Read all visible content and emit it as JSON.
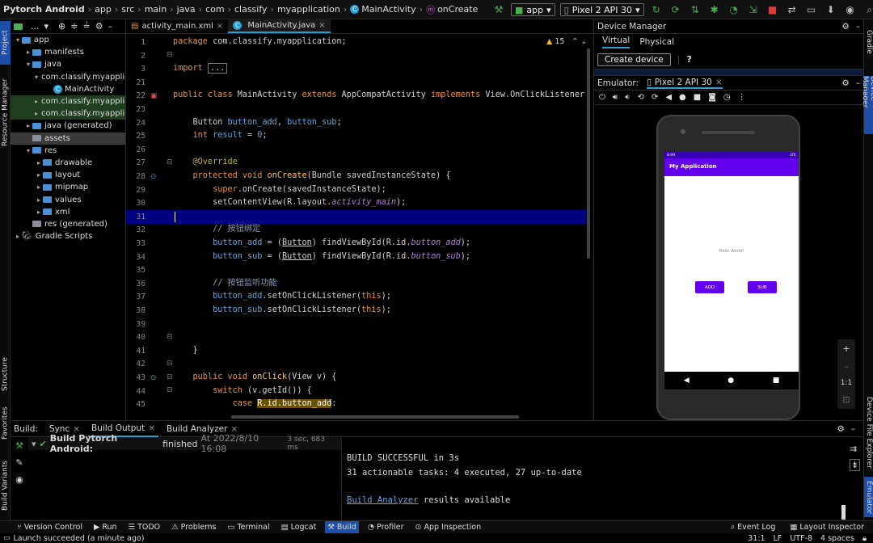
{
  "title_bar": {
    "breadcrumbs": [
      "Pytorch Android",
      "app",
      "src",
      "main",
      "java",
      "com",
      "classify",
      "myapplication",
      "MainActivity",
      "onCreate"
    ],
    "run_config": "app",
    "device": "Pixel 2 API 30"
  },
  "left_strip": {
    "project": "Project",
    "resource_manager": "Resource Manager",
    "structure": "Structure",
    "favorites": "Favorites",
    "build_variants": "Build Variants"
  },
  "right_strip": {
    "gradle": "Gradle",
    "device_manager": "Device Manager",
    "device_file_explorer": "Device File Explorer",
    "emulator": "Emulator"
  },
  "project": {
    "view": "...",
    "tree": [
      {
        "label": "app",
        "depth": 0,
        "icon": "folder",
        "chev": "▾",
        "state": ""
      },
      {
        "label": "manifests",
        "depth": 1,
        "icon": "folder",
        "chev": "▸",
        "state": ""
      },
      {
        "label": "java",
        "depth": 1,
        "icon": "folder",
        "chev": "▾",
        "state": ""
      },
      {
        "label": "com.classify.myapplic",
        "depth": 2,
        "icon": "folder",
        "chev": "▾",
        "state": ""
      },
      {
        "label": "MainActivity",
        "depth": 3,
        "icon": "class",
        "chev": "",
        "state": ""
      },
      {
        "label": "com.classify.myapplica",
        "depth": 2,
        "icon": "folder",
        "chev": "▸",
        "state": "sel"
      },
      {
        "label": "com.classify.myapplica",
        "depth": 2,
        "icon": "folder",
        "chev": "▸",
        "state": "sel"
      },
      {
        "label": "java (generated)",
        "depth": 1,
        "icon": "folder",
        "chev": "▸",
        "state": ""
      },
      {
        "label": "assets",
        "depth": 1,
        "icon": "folder-grey",
        "chev": "",
        "state": "hl"
      },
      {
        "label": "res",
        "depth": 1,
        "icon": "folder",
        "chev": "▾",
        "state": ""
      },
      {
        "label": "drawable",
        "depth": 2,
        "icon": "folder",
        "chev": "▸",
        "state": ""
      },
      {
        "label": "layout",
        "depth": 2,
        "icon": "folder",
        "chev": "▸",
        "state": ""
      },
      {
        "label": "mipmap",
        "depth": 2,
        "icon": "folder",
        "chev": "▸",
        "state": ""
      },
      {
        "label": "values",
        "depth": 2,
        "icon": "folder",
        "chev": "▸",
        "state": ""
      },
      {
        "label": "xml",
        "depth": 2,
        "icon": "folder",
        "chev": "▸",
        "state": ""
      },
      {
        "label": "res (generated)",
        "depth": 1,
        "icon": "folder-grey",
        "chev": "",
        "state": ""
      },
      {
        "label": "Gradle Scripts",
        "depth": 0,
        "icon": "gradle",
        "chev": "▸",
        "state": ""
      }
    ]
  },
  "editor": {
    "tabs": [
      {
        "label": "activity_main.xml",
        "active": false
      },
      {
        "label": "MainActivity.java",
        "active": true
      }
    ],
    "warnings": "15",
    "line_numbers": [
      "1",
      "2",
      "3",
      "21",
      "22",
      "23",
      "24",
      "25",
      "26",
      "27",
      "28",
      "29",
      "30",
      "31",
      "32",
      "33",
      "34",
      "35",
      "36",
      "37",
      "38",
      "39",
      "40",
      "41",
      "42",
      "43",
      "44",
      "45"
    ],
    "lines": [
      [
        [
          "kw",
          "package "
        ],
        [
          "",
          "com.classify.myapplication;"
        ]
      ],
      [],
      [
        [
          "kw",
          "import "
        ],
        [
          "",
          "..."
        ]
      ],
      [],
      [
        [
          "kw",
          "public class "
        ],
        [
          "",
          "MainActivity "
        ],
        [
          "kw",
          "extends "
        ],
        [
          "",
          "AppCompatActivity "
        ],
        [
          "kw",
          "implements "
        ],
        [
          "",
          "View.OnClickListener {"
        ]
      ],
      [],
      [
        [
          "",
          "    Button "
        ],
        [
          "nm",
          "button_add"
        ],
        [
          "",
          ", "
        ],
        [
          "nm",
          "button_sub"
        ],
        [
          "",
          ";"
        ]
      ],
      [
        [
          "kw",
          "    int "
        ],
        [
          "nm",
          "result"
        ],
        [
          "",
          " = "
        ],
        [
          "nm",
          "0"
        ],
        [
          "",
          ";"
        ]
      ],
      [],
      [
        [
          "an",
          "    @Override"
        ]
      ],
      [
        [
          "kw",
          "    protected void "
        ],
        [
          "fn",
          "onCreate"
        ],
        [
          "",
          "(Bundle savedInstanceState) {"
        ]
      ],
      [
        [
          "kw",
          "        super"
        ],
        [
          "",
          ".onCreate(savedInstanceState);"
        ]
      ],
      [
        [
          "",
          "        setContentView(R.layout."
        ],
        [
          "it",
          "activity_main"
        ],
        [
          "",
          ");"
        ]
      ],
      [],
      [
        [
          "cm",
          "        // 按钮绑定"
        ]
      ],
      [
        [
          "",
          "        "
        ],
        [
          "nm",
          "button_add"
        ],
        [
          "",
          " = ("
        ],
        [
          "ul",
          "Button"
        ],
        [
          "",
          ") findViewById(R.id."
        ],
        [
          "it",
          "button_add"
        ],
        [
          "",
          ");"
        ]
      ],
      [
        [
          "",
          "        "
        ],
        [
          "nm",
          "button_sub"
        ],
        [
          "",
          " = ("
        ],
        [
          "ul",
          "Button"
        ],
        [
          "",
          ") findViewById(R.id."
        ],
        [
          "it",
          "button_sub"
        ],
        [
          "",
          ");"
        ]
      ],
      [],
      [
        [
          "cm",
          "        // 按钮监听功能"
        ]
      ],
      [
        [
          "",
          "        "
        ],
        [
          "nm",
          "button_add"
        ],
        [
          "",
          ".setOnClickListener("
        ],
        [
          "kw",
          "this"
        ],
        [
          "",
          ");"
        ]
      ],
      [
        [
          "",
          "        "
        ],
        [
          "nm",
          "button_sub"
        ],
        [
          "",
          ".setOnClickListener("
        ],
        [
          "kw",
          "this"
        ],
        [
          "",
          ");"
        ]
      ],
      [],
      [],
      [
        [
          "",
          "    }"
        ]
      ],
      [],
      [
        [
          "kw",
          "    public void "
        ],
        [
          "fn",
          "onClick"
        ],
        [
          "",
          "(View v) {"
        ]
      ],
      [
        [
          "kw",
          "        switch "
        ],
        [
          "",
          "(v.getId()) {"
        ]
      ],
      [
        [
          "kw",
          "            case "
        ],
        [
          "gold",
          "R.id.button_add"
        ],
        [
          "",
          ":"
        ]
      ]
    ]
  },
  "device_manager": {
    "title": "Device Manager",
    "tabs": [
      "Virtual",
      "Physical"
    ],
    "create_device": "Create device",
    "help": "?"
  },
  "emulator": {
    "label": "Emulator:",
    "tab": "Pixel 2 API 30",
    "status_time": "8:09",
    "status_right": "LTE",
    "app_title": "My Application",
    "hello": "Hello World!",
    "add_button": "ADD",
    "sub_button": "SUB",
    "zoom_ratio": "1:1"
  },
  "bottom": {
    "label": "Build:",
    "tabs": [
      {
        "label": "Sync",
        "active": false
      },
      {
        "label": "Build Output",
        "active": true
      },
      {
        "label": "Build Analyzer",
        "active": false
      }
    ],
    "build_title": "Build Pytorch Android:",
    "build_status": "finished",
    "build_time": "At 2022/8/10 16:08",
    "duration": "3 sec, 683 ms",
    "console": [
      "BUILD SUCCESSFUL in 3s",
      "31 actionable tasks: 4 executed, 27 up-to-date",
      "",
      "Build Analyzer",
      " results available"
    ]
  },
  "toolwindows": [
    "Version Control",
    "Run",
    "TODO",
    "Problems",
    "Terminal",
    "Logcat",
    "Build",
    "Profiler",
    "App Inspection"
  ],
  "toolwindows_right": [
    "Event Log",
    "Layout Inspector"
  ],
  "statusbar": {
    "message": "Launch succeeded (a minute ago)",
    "position": "31:1",
    "line_sep": "LF",
    "encoding": "UTF-8",
    "indent": "4 spaces"
  },
  "colors": {
    "accent": "#2a9fd6",
    "current_line": "#000080",
    "app_purple": "#6200ee"
  }
}
